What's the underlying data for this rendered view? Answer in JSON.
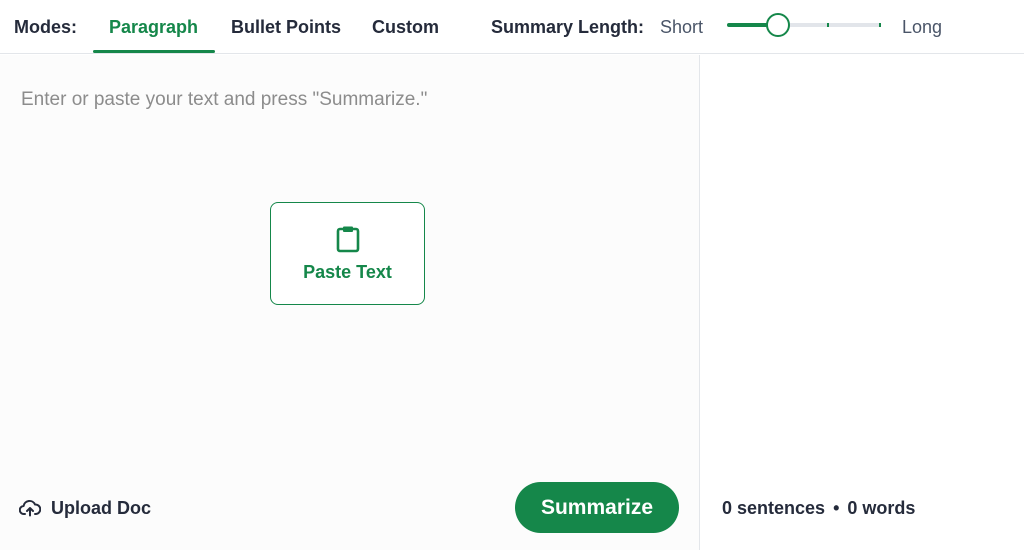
{
  "toolbar": {
    "modes_label": "Modes:",
    "tabs": [
      {
        "label": "Paragraph",
        "active": true
      },
      {
        "label": "Bullet Points",
        "active": false
      },
      {
        "label": "Custom",
        "active": false
      }
    ],
    "length_label": "Summary Length:",
    "length_min_label": "Short",
    "length_max_label": "Long",
    "length_value": 0.33,
    "length_ticks": [
      0.66,
      1.0
    ]
  },
  "input": {
    "placeholder": "Enter or paste your text and press \"Summarize.\"",
    "value": "",
    "paste_label": "Paste Text",
    "paste_icon": "clipboard-icon",
    "upload_label": "Upload Doc",
    "upload_icon": "cloud-upload-icon",
    "summarize_label": "Summarize"
  },
  "output": {
    "sentences_count": "0 sentences",
    "separator": "•",
    "words_count": "0 words"
  },
  "colors": {
    "accent": "#15874a",
    "text": "#252b3b",
    "placeholder": "#8c8c8c"
  }
}
